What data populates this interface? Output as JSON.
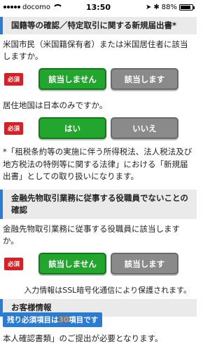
{
  "status_bar": {
    "carrier": "docomo",
    "time": "13:50",
    "battery": "88%",
    "battery_level": 0.88
  },
  "section1": {
    "title": "国籍等の確認／特定取引に関する新規届出書*",
    "q1": {
      "text": "米国市民（米国籍保有者）または米国居住者に該当しますか。",
      "required": "必須",
      "options": [
        "該当しません",
        "該当します"
      ],
      "selected": 0
    },
    "q2": {
      "text": "居住地国は日本のみですか。",
      "required": "必須",
      "options": [
        "はい",
        "いいえ"
      ],
      "selected": 0
    },
    "note": "*「租税条約等の実施に伴う所得税法、法人税法及び地方税法の特例等に関する法律」における「新規届出書」としての取り扱いになります。"
  },
  "section2": {
    "title": "金融先物取引業務に従事する役職員でないことの確認",
    "q1": {
      "text": "金融先物取引業務に従事する役職員に該当しますか。",
      "required": "必須",
      "options": [
        "該当しません",
        "該当します"
      ],
      "selected": 0
    }
  },
  "ssl_notice": "入力情報はSSL暗号化通信により保護されます。",
  "section3": {
    "title": "お客様情報",
    "partial_text": "本人確認書類」のご提出が必要となります。"
  },
  "remaining": {
    "prefix": "残り必須項目は",
    "count": "30",
    "suffix": "項目です"
  },
  "colors": {
    "accent": "#2a7bd3",
    "selected": "#22a62d",
    "unselected": "#8a8a8a",
    "required": "#d71f26",
    "count_highlight": "#ff9a2e"
  }
}
